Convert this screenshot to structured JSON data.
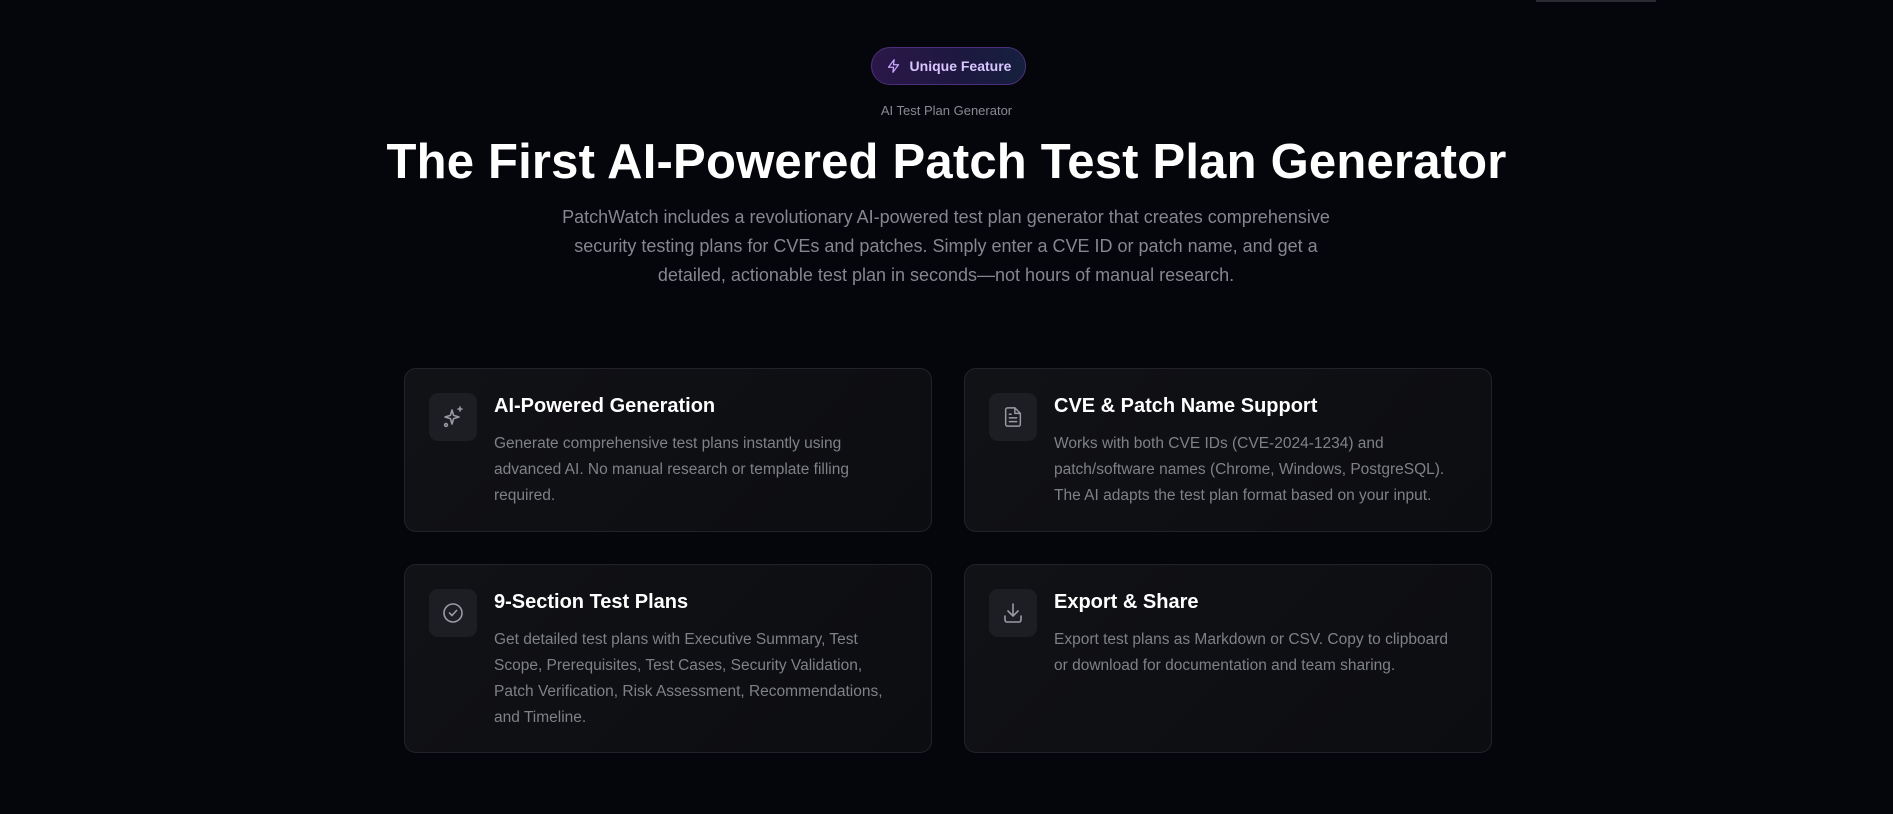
{
  "badge": {
    "label": "Unique Feature",
    "icon": "lightning-icon"
  },
  "section": {
    "eyebrow": "AI Test Plan Generator",
    "title": "The First AI-Powered Patch Test Plan Generator",
    "description": "PatchWatch includes a revolutionary AI-powered test plan generator that creates comprehensive security testing plans for CVEs and patches. Simply enter a CVE ID or patch name, and get a detailed, actionable test plan in seconds—not hours of manual research."
  },
  "features": [
    {
      "icon": "sparkles-icon",
      "title": "AI-Powered Generation",
      "description": "Generate comprehensive test plans instantly using advanced AI. No manual research or template filling required."
    },
    {
      "icon": "document-icon",
      "title": "CVE & Patch Name Support",
      "description": "Works with both CVE IDs (CVE-2024-1234) and patch/software names (Chrome, Windows, PostgreSQL). The AI adapts the test plan format based on your input."
    },
    {
      "icon": "check-circle-icon",
      "title": "9-Section Test Plans",
      "description": "Get detailed test plans with Executive Summary, Test Scope, Prerequisites, Test Cases, Security Validation, Patch Verification, Risk Assessment, Recommendations, and Timeline."
    },
    {
      "icon": "download-icon",
      "title": "Export & Share",
      "description": "Export test plans as Markdown or CSV. Copy to clipboard or download for documentation and team sharing."
    }
  ],
  "colors": {
    "background": "#05060b",
    "badge_text": "#d9c6ff",
    "card_border": "#22232a",
    "muted_text": "#7f8088"
  }
}
